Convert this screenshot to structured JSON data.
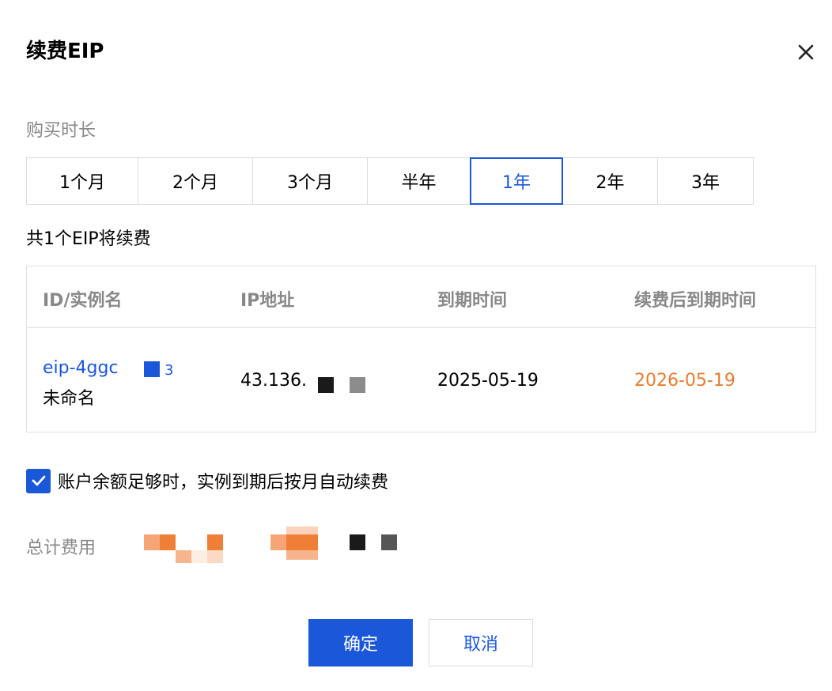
{
  "dialog": {
    "title": "续费EIP",
    "close_icon": "close-icon"
  },
  "duration": {
    "label": "购买时长",
    "options": [
      "1个月",
      "2个月",
      "3个月",
      "半年",
      "1年",
      "2年",
      "3年"
    ],
    "selected": "1年"
  },
  "summary": {
    "count_text": "共1个EIP将续费"
  },
  "table": {
    "headers": [
      "ID/实例名",
      "IP地址",
      "到期时间",
      "续费后到期时间"
    ],
    "rows": [
      {
        "id": "eip-4ggc",
        "id_tail": "3",
        "name": "未命名",
        "ip": "43.136.",
        "expiry": "2025-05-19",
        "new_expiry": "2026-05-19"
      }
    ]
  },
  "auto_renew": {
    "checked": true,
    "label": "账户余额足够时，实例到期后按月自动续费"
  },
  "total": {
    "label": "总计费用"
  },
  "buttons": {
    "confirm": "确定",
    "cancel": "取消"
  },
  "colors": {
    "primary": "#1b57d9",
    "accent_orange": "#e97b2f",
    "muted_text": "#888888",
    "border": "#dcdcdc"
  }
}
